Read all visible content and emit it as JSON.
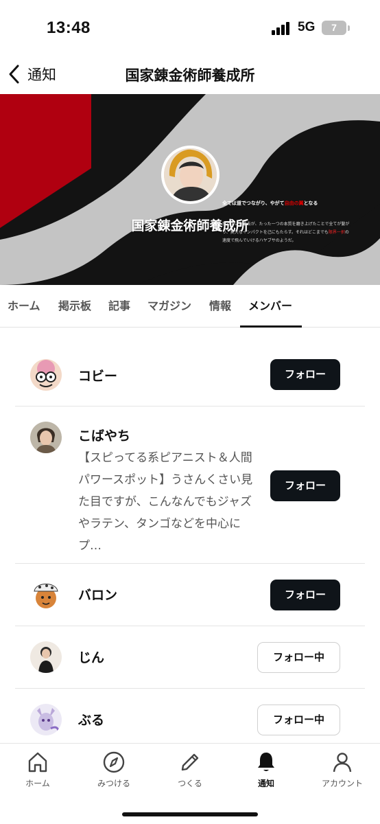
{
  "status": {
    "time": "13:48",
    "network": "5G",
    "battery": "7"
  },
  "nav": {
    "back_label": "通知",
    "title": "国家錬金術師養成所"
  },
  "banner": {
    "title": "国家錬金術師養成所",
    "tagline_pre": "全ては道でつながり、やがて",
    "tagline_red": "自由の翼",
    "tagline_post": "となる",
    "desc_pre": "思っていた過去が、たった一つの本質を磨き上げたことで全てが繋がり、莫大なインパクトを己にもたらす。それはどこまでも",
    "desc_red": "限界一択",
    "desc_post": "の速度で飛んでいけるハヤブサのようだ。",
    "colors": {
      "red": "#b00010",
      "grey": "#c4c4c4",
      "dark": "#131313"
    }
  },
  "tabs": [
    {
      "label": "ホーム"
    },
    {
      "label": "掲示板"
    },
    {
      "label": "記事"
    },
    {
      "label": "マガジン"
    },
    {
      "label": "情報"
    },
    {
      "label": "メンバー"
    }
  ],
  "members": [
    {
      "name": "コビー",
      "bio": "",
      "button": "フォロー"
    },
    {
      "name": "こばやち",
      "bio": "【スピってる系ピアニスト＆人間パワースポット】うさんくさい見た目ですが、こんなんでもジャズやラテン、タンゴなどを中心にプ…",
      "button": "フォロー"
    },
    {
      "name": "バロン",
      "bio": "",
      "button": "フォロー"
    },
    {
      "name": "じん",
      "bio": "",
      "button": "フォロー中"
    },
    {
      "name": "ぶる",
      "bio": "",
      "button": "フォロー中"
    }
  ],
  "tabbar": [
    {
      "label": "ホーム",
      "icon": "home-icon"
    },
    {
      "label": "みつける",
      "icon": "compass-icon"
    },
    {
      "label": "つくる",
      "icon": "pencil-icon"
    },
    {
      "label": "通知",
      "icon": "bell-icon"
    },
    {
      "label": "アカウント",
      "icon": "person-icon"
    }
  ],
  "accent": "#0f1419"
}
